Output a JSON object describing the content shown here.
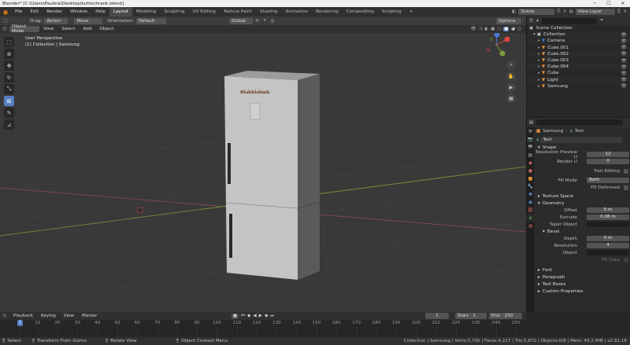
{
  "window": {
    "title": "Blender* [C:\\Users\\Paulina\\Desktop\\kuhlschrank.blend]",
    "controls": [
      "─",
      "☐",
      "✕"
    ]
  },
  "topbar": {
    "menus": [
      "File",
      "Edit",
      "Render",
      "Window",
      "Help"
    ],
    "workspaces": [
      "Layout",
      "Modeling",
      "Sculpting",
      "UV Editing",
      "Texture Paint",
      "Shading",
      "Animation",
      "Rendering",
      "Compositing",
      "Scripting"
    ],
    "active_workspace": "Layout",
    "add_tab": "+",
    "scene": "Scene",
    "view_layer": "View Layer"
  },
  "toolsettings": {
    "drag_label": "Drag:",
    "drag_value": "Action",
    "move_value": "Move",
    "orientation_label": "Orientation:",
    "orientation_value": "Default",
    "global": "Global",
    "options": "Options"
  },
  "viewport_header": {
    "mode": "Object Mode",
    "menus": [
      "View",
      "Select",
      "Add",
      "Object"
    ]
  },
  "viewport": {
    "perspective": "User Perspective",
    "collection": "(1) Collection | Samsung",
    "brand_text": "Blahblahmk"
  },
  "outliner": {
    "root": "Scene Collection",
    "collection": "Collection",
    "items": [
      {
        "name": "Camera",
        "icon_color": "#3a7bd5"
      },
      {
        "name": "Cube.001",
        "icon_color": "#e08a3b"
      },
      {
        "name": "Cube.002",
        "icon_color": "#e08a3b"
      },
      {
        "name": "Cube.003",
        "icon_color": "#e08a3b"
      },
      {
        "name": "Cube.004",
        "icon_color": "#e08a3b"
      },
      {
        "name": "Cube",
        "icon_color": "#e08a3b"
      },
      {
        "name": "Light",
        "icon_color": "#e08a3b"
      },
      {
        "name": "Samsung",
        "icon_color": "#e08a3b"
      }
    ]
  },
  "properties": {
    "object_name": "Samsung",
    "data_name": "Text",
    "datablock": "Text",
    "sections": {
      "shape": "Shape",
      "texture_space": "Texture Space",
      "geometry": "Geometry",
      "bevel": "Bevel",
      "font": "Font",
      "paragraph": "Paragraph",
      "text_boxes": "Text Boxes",
      "custom_properties": "Custom Properties"
    },
    "shape": {
      "resolution_preview_label": "Resolution Preview U",
      "resolution_preview_value": "12",
      "render_u_label": "Render U",
      "render_u_value": "0",
      "fast_editing_label": "Fast Editing",
      "fill_mode_label": "Fill Mode",
      "fill_mode_value": "Both",
      "fill_deformed_label": "Fill Deformed"
    },
    "geometry": {
      "offset_label": "Offset",
      "offset_value": "0 m",
      "extrude_label": "Extrude",
      "extrude_value": "0.08 m",
      "taper_label": "Taper Object"
    },
    "bevel": {
      "depth_label": "Depth",
      "depth_value": "0 m",
      "resolution_label": "Resolution",
      "resolution_value": "4",
      "object_label": "Object",
      "fill_caps_label": "Fill Caps"
    }
  },
  "timeline": {
    "menus": [
      "Playback",
      "Keying",
      "View",
      "Marker"
    ],
    "current_frame": "1",
    "start_label": "Start",
    "start_value": "1",
    "end_label": "End",
    "end_value": "250",
    "ticks": [
      "1",
      "10",
      "20",
      "30",
      "40",
      "50",
      "60",
      "70",
      "80",
      "90",
      "100",
      "110",
      "120",
      "130",
      "140",
      "150",
      "160",
      "170",
      "180",
      "190",
      "200",
      "210",
      "220",
      "230",
      "240",
      "250"
    ]
  },
  "status": {
    "select": "Select",
    "transform": "Transform From Gizmo",
    "rotate": "Rotate View",
    "context": "Object Context Menu",
    "info": "Collection | Samsung | Verts:5,700 | Faces:4,227 | Tris:5,672 | Objects:0/8 | Mem: 43.2 MiB | v2.81.16"
  },
  "colors": {
    "accent": "#5680c2",
    "viewport_bg": "#393939",
    "fridge_front": "#c4c4c4",
    "fridge_side": "#5a5a5a",
    "x_axis": "#8a4d4d",
    "y_axis": "#7b9c3a"
  }
}
